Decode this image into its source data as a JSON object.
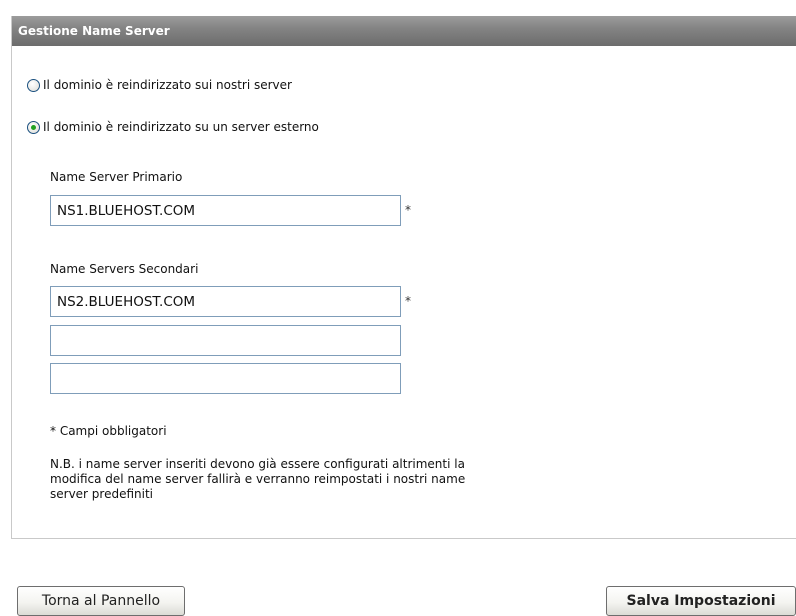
{
  "panel": {
    "title": "Gestione Name Server",
    "options": [
      {
        "label": "Il dominio è reindirizzato sui nostri server",
        "checked": false
      },
      {
        "label": "Il dominio è reindirizzato su un server esterno",
        "checked": true
      }
    ],
    "primary": {
      "label": "Name Server Primario",
      "value": "NS1.BLUEHOST.COM",
      "required_mark": "*"
    },
    "secondary": {
      "label": "Name Servers Secondari",
      "values": [
        "NS2.BLUEHOST.COM",
        "",
        ""
      ],
      "required_mark": "*"
    },
    "required_note": "* Campi obbligatori",
    "info_note": "N.B. i name server inseriti devono già essere configurati altrimenti la modifica del name server fallirà e verranno reimpostati i nostri name server predefiniti"
  },
  "buttons": {
    "back": "Torna al Pannello",
    "save": "Salva Impostazioni"
  }
}
